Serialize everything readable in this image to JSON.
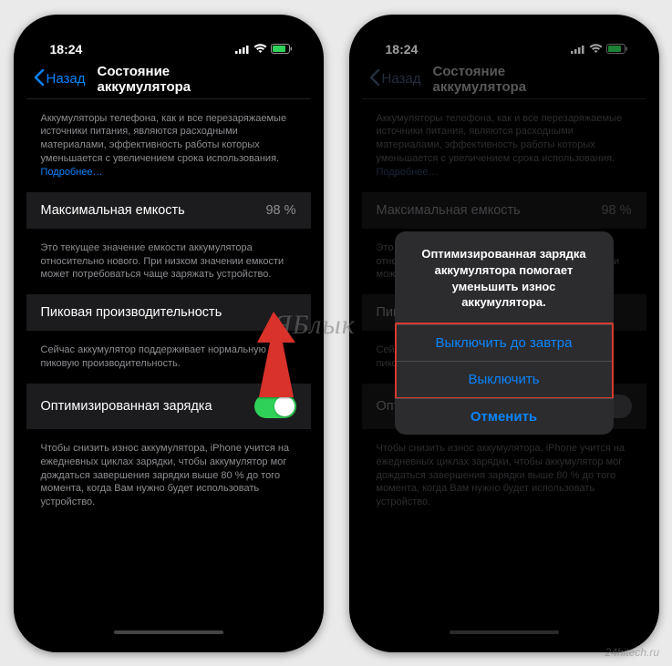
{
  "status": {
    "time": "18:24"
  },
  "nav": {
    "back": "Назад",
    "title": "Состояние аккумулятора"
  },
  "desc1": {
    "text": "Аккумуляторы телефона, как и все перезаряжаемые источники питания, являются расходными материалами, эффективность работы которых уменьшается с увеличением срока использования.",
    "more": "Подробнее…"
  },
  "capacity": {
    "label": "Максимальная емкость",
    "value": "98 %"
  },
  "desc2": "Это текущее значение емкости аккумулятора относительно нового. При низком значении емкости может потребоваться чаще заряжать устройство.",
  "peak": {
    "label": "Пиковая производительность"
  },
  "desc3": "Сейчас аккумулятор поддерживает нормальную пиковую производительность.",
  "optimized": {
    "label": "Оптимизированная зарядка"
  },
  "desc4": "Чтобы снизить износ аккумулятора, iPhone учится на ежедневных циклах зарядки, чтобы аккумулятор мог дождаться завершения зарядки выше 80 % до того момента, когда Вам нужно будет использовать устройство.",
  "alert": {
    "title": "Оптимизированная зарядка аккумулятора помогает уменьшить износ аккумулятора.",
    "btn1": "Выключить до завтра",
    "btn2": "Выключить",
    "cancel": "Отменить"
  },
  "watermark": "ЯБлык",
  "credit": "24hitech.ru"
}
